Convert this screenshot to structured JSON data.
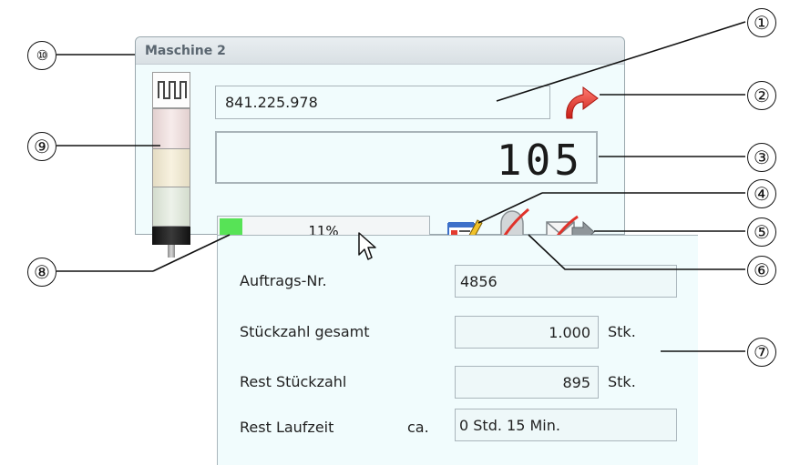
{
  "window": {
    "title": "Maschine 2",
    "counter_value": "841.225.978",
    "piece_count": "105",
    "progress": {
      "label": "11%",
      "fraction": 0.11
    }
  },
  "light_tower": {
    "segments": [
      "white-pulse-icon",
      "red",
      "yellow",
      "green",
      "black-base"
    ]
  },
  "popup": {
    "rows": [
      {
        "label": "Auftrags-Nr.",
        "value": "4856",
        "unit": ""
      },
      {
        "label": "Stückzahl gesamt",
        "value": "1.000",
        "unit": "Stk."
      },
      {
        "label": "Rest Stückzahl",
        "value": "895",
        "unit": "Stk."
      },
      {
        "label": "Rest Laufzeit",
        "prefix": "ca.",
        "value": "0 Std. 15 Min.",
        "unit": ""
      }
    ]
  },
  "callouts": [
    "①",
    "②",
    "③",
    "④",
    "⑤",
    "⑥",
    "⑦",
    "⑧",
    "⑨",
    "⑩"
  ],
  "icons": {
    "redirect": "redirect-arrow-icon",
    "order_edit": "order-edit-icon",
    "alarm_disabled": "bell-disabled-icon",
    "mail_forward_disabled": "mail-forward-disabled-icon",
    "cursor": "mouse-pointer-icon"
  },
  "colors": {
    "window_bg": "#f1fcfd",
    "progress_fill": "#57e356",
    "redirect_arrow": "#e8312a",
    "disabled_stroke": "#e0322a"
  }
}
